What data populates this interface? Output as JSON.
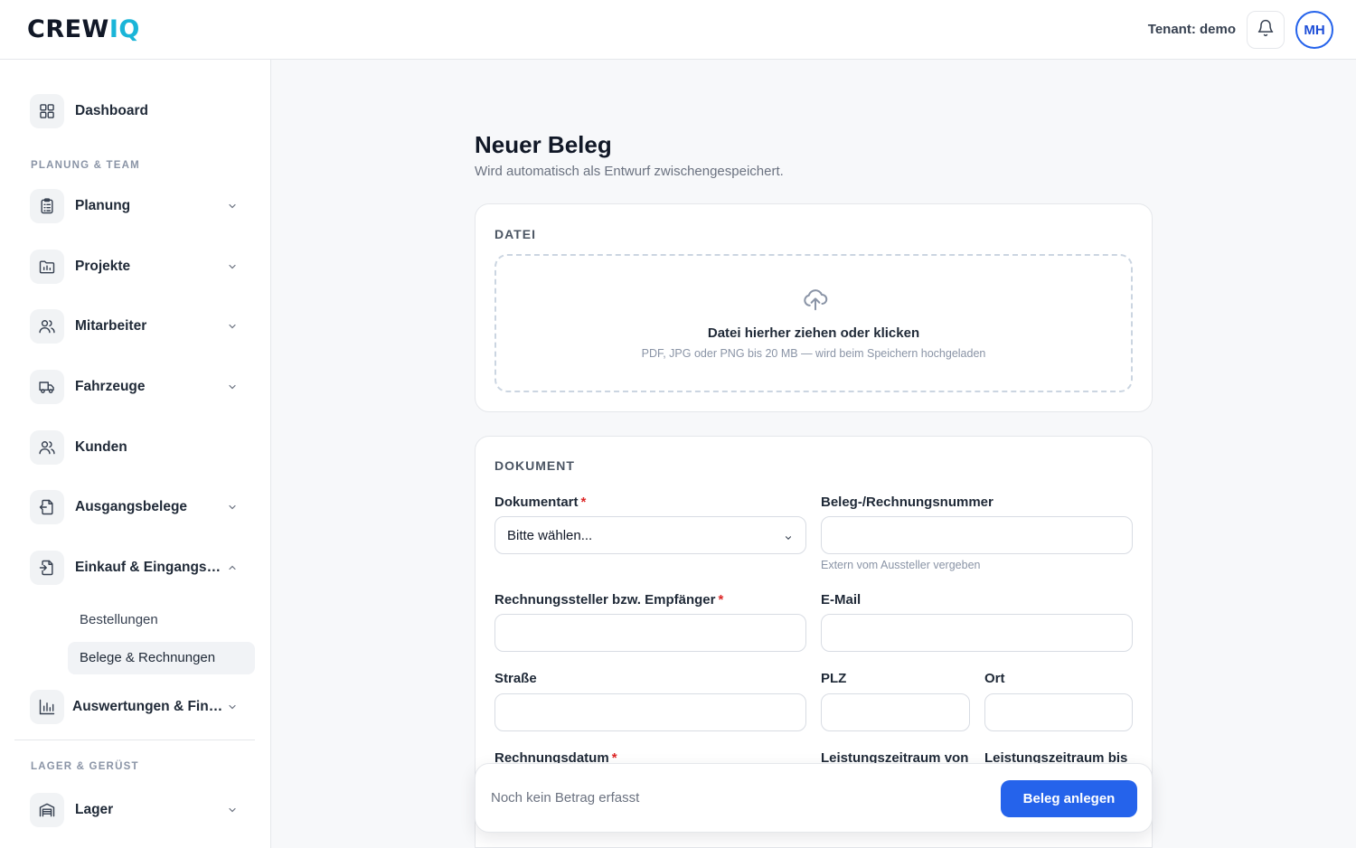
{
  "header": {
    "logo_main": "CREW",
    "logo_accent": "IQ",
    "tenant": "Tenant: demo",
    "avatar_initials": "MH"
  },
  "sidebar": {
    "dashboard": "Dashboard",
    "section_planning": "PLANUNG & TEAM",
    "planung": "Planung",
    "projekte": "Projekte",
    "mitarbeiter": "Mitarbeiter",
    "fahrzeuge": "Fahrzeuge",
    "kunden": "Kunden",
    "ausgangsbelege": "Ausgangsbelege",
    "einkauf": "Einkauf & Eingangsbelege",
    "einkauf_sub": [
      "Bestellungen",
      "Belege & Rechnungen"
    ],
    "auswertungen": "Auswertungen & Finanzen",
    "section_lager": "LAGER & GERÜST",
    "lager": "Lager"
  },
  "page": {
    "title": "Neuer Beleg",
    "subtitle": "Wird automatisch als Entwurf zwischengespeichert."
  },
  "file_card": {
    "title": "DATEI",
    "drop_title": "Datei hierher ziehen oder klicken",
    "drop_hint": "PDF, JPG oder PNG bis 20 MB — wird beim Speichern hochgeladen"
  },
  "doc_card": {
    "title": "DOKUMENT",
    "doc_type_label": "Dokumentart",
    "doc_type_value": "Bitte wählen...",
    "number_label": "Beleg-/Rechnungsnummer",
    "number_value": "",
    "number_hint": "Extern vom Aussteller vergeben",
    "issuer_label": "Rechnungssteller bzw. Empfänger",
    "issuer_value": "",
    "email_label": "E-Mail",
    "email_value": "",
    "street_label": "Straße",
    "street_value": "",
    "zip_label": "PLZ",
    "zip_value": "",
    "city_label": "Ort",
    "city_value": "",
    "invoice_date_label": "Rechnungsdatum",
    "period_from_label": "Leistungszeitraum von",
    "period_to_label": "Leistungszeitraum bis",
    "required_mark": "*"
  },
  "bottom_bar": {
    "status": "Noch kein Betrag erfasst",
    "submit": "Beleg anlegen"
  },
  "colors": {
    "primary": "#2563eb",
    "logo_accent": "#1ab5d8",
    "required": "#dc2626"
  }
}
